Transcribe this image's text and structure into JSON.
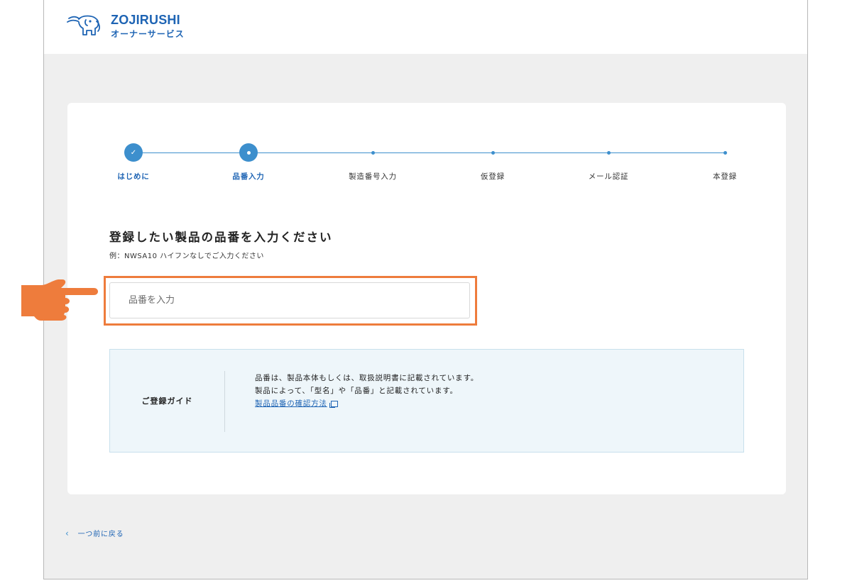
{
  "header": {
    "brand_name": "ZOJIRUSHI",
    "brand_sub": "オーナーサービス",
    "logo_icon": "elephant-logo-icon"
  },
  "stepper": {
    "steps": [
      {
        "label": "はじめに",
        "state": "done"
      },
      {
        "label": "品番入力",
        "state": "current"
      },
      {
        "label": "製造番号入力",
        "state": "upcoming"
      },
      {
        "label": "仮登録",
        "state": "upcoming"
      },
      {
        "label": "メール認証",
        "state": "upcoming"
      },
      {
        "label": "本登録",
        "state": "upcoming"
      }
    ],
    "done_icon": "check-icon"
  },
  "form": {
    "title": "登録したい製品の品番を入力ください",
    "hint": "例：NWSA10 ハイフンなしでご入力ください",
    "input_placeholder": "品番を入力",
    "input_value": ""
  },
  "guide": {
    "title": "ご登録ガイド",
    "line1": "品番は、製品本体もしくは、取扱説明書に記載されています。",
    "line2": "製品によって、「型名」や「品番」と記載されています。",
    "link_text": "製品品番の確認方法",
    "link_icon": "external-window-icon"
  },
  "nav": {
    "back_label": "一つ前に戻る",
    "back_icon": "chevron-left-icon"
  },
  "annotation": {
    "pointer_icon": "pointing-hand-icon"
  },
  "colors": {
    "accent": "#3d8fcd",
    "brand": "#1e64b4",
    "highlight": "#ee7c3c",
    "guide_bg": "#eef6fa",
    "page_bg": "#efefef"
  }
}
